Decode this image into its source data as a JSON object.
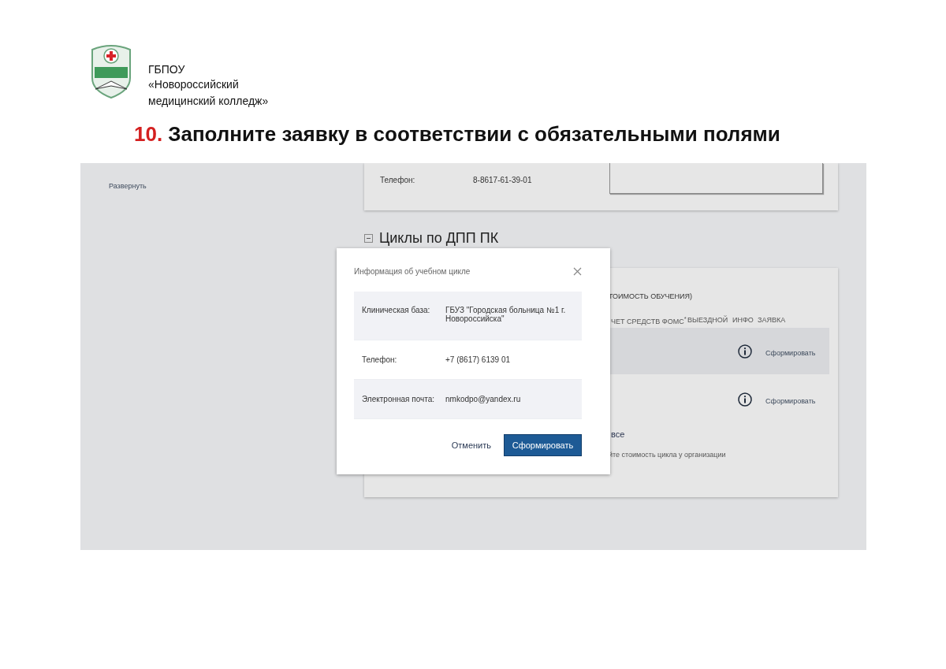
{
  "slide": {
    "org_lines": [
      "ГБПОУ",
      "«Новороссийский",
      "медицинский колледж»"
    ],
    "step_number": "10.",
    "title": "Заполните заявку в соответствии с обязательными полями"
  },
  "screen": {
    "sidebar": {
      "expand_link": "Развернуть"
    },
    "contact_card": {
      "rows": [
        {
          "label": "Телефон:",
          "value": "8-8617-61-39-01"
        }
      ]
    },
    "section": {
      "title": "Циклы по ДПП ПК",
      "expanded": true
    },
    "cycles_card": {
      "header_text": "ТОИМОСТЬ ОБУЧЕНИЯ)",
      "columns": [
        "ЧЕТ СРЕДСТВ ФОМС$^{*}$",
        "ВЫЕЗДНОЙ",
        "ИНФО",
        "ЗАЯВКА"
      ],
      "rows": [
        {
          "selected": true,
          "action": "Сформировать"
        },
        {
          "selected": false,
          "action": "Сформировать"
        }
      ],
      "show_all_link": "все",
      "note": "йте стоимость цикла у организации"
    },
    "modal": {
      "title": "Информация об учебном цикле",
      "fields": [
        {
          "label": "Клиническая база:",
          "value": "ГБУЗ \"Городская больница №1 г. Новороссийска\""
        },
        {
          "label": "Телефон:",
          "value": "+7 (8617) 6139 01"
        },
        {
          "label": "Электронная почта:",
          "value": "nmkodpo@yandex.ru"
        }
      ],
      "cancel_button": "Отменить",
      "submit_button": "Сформировать"
    }
  }
}
